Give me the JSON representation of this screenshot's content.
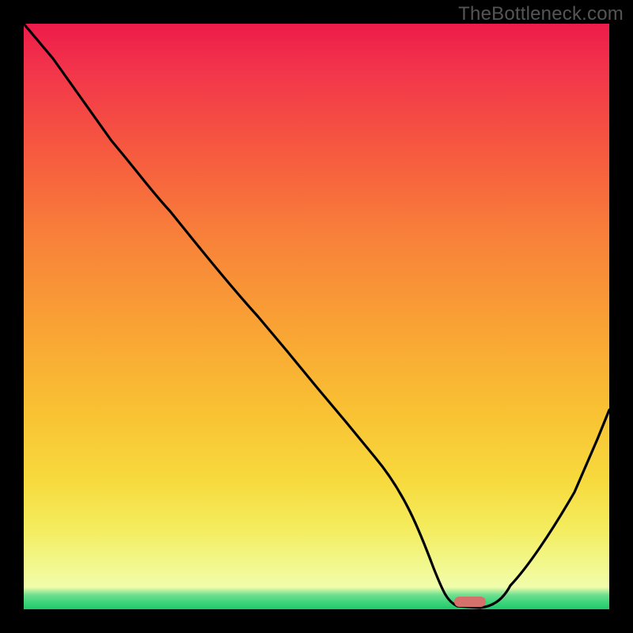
{
  "watermark": "TheBottleneck.com",
  "chart_data": {
    "type": "line",
    "title": "",
    "xlabel": "",
    "ylabel": "",
    "x": [
      0.0,
      0.05,
      0.1,
      0.15,
      0.2,
      0.25,
      0.3,
      0.35,
      0.4,
      0.45,
      0.5,
      0.55,
      0.6,
      0.65,
      0.7,
      0.72,
      0.74,
      0.78,
      0.82,
      0.86,
      0.9,
      0.94,
      0.98,
      1.0
    ],
    "values": [
      1.0,
      0.94,
      0.87,
      0.8,
      0.74,
      0.68,
      0.6,
      0.52,
      0.44,
      0.36,
      0.28,
      0.2,
      0.13,
      0.07,
      0.03,
      0.01,
      0.0,
      0.0,
      0.02,
      0.06,
      0.12,
      0.2,
      0.29,
      0.34
    ],
    "xlim": [
      0,
      1
    ],
    "ylim": [
      0,
      1
    ],
    "marker": {
      "x": 0.76,
      "y": 0.0
    },
    "gradient_stops": [
      {
        "pos": 0.0,
        "color": "#ee1b4a"
      },
      {
        "pos": 0.5,
        "color": "#f9a334"
      },
      {
        "pos": 0.9,
        "color": "#f2f78a"
      },
      {
        "pos": 1.0,
        "color": "#1fc96b"
      }
    ]
  }
}
